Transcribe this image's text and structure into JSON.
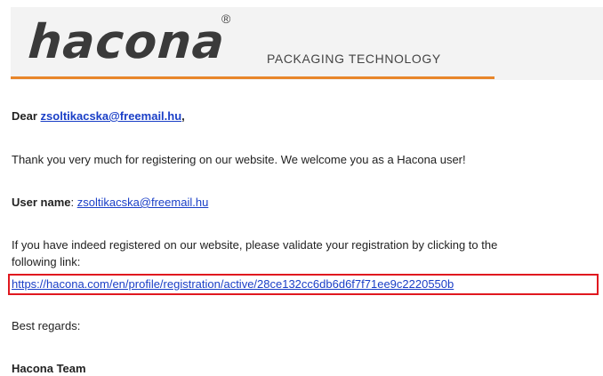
{
  "header": {
    "logo_text": "hacona",
    "registered_mark": "®",
    "tagline": "PACKAGING TECHNOLOGY",
    "accent_color": "#e8862a"
  },
  "email": {
    "greeting_prefix": "Dear ",
    "greeting_email": "zsoltikacska@freemail.hu",
    "greeting_suffix": ",",
    "thank_you": "Thank you very much for registering on our website. We welcome you as a Hacona user!",
    "username_label": "User name",
    "username_separator": ": ",
    "username_value": "zsoltikacska@freemail.hu",
    "validate_line1": "If you have indeed registered on our website, please validate your registration by clicking to the",
    "validate_line2": "following link:",
    "activation_link": "https://hacona.com/en/profile/registration/active/28ce132cc6db6d6f7f71ee9c2220550b",
    "closing": "Best regards:",
    "signature": "Hacona Team"
  },
  "highlight": {
    "color": "#e0181f"
  }
}
